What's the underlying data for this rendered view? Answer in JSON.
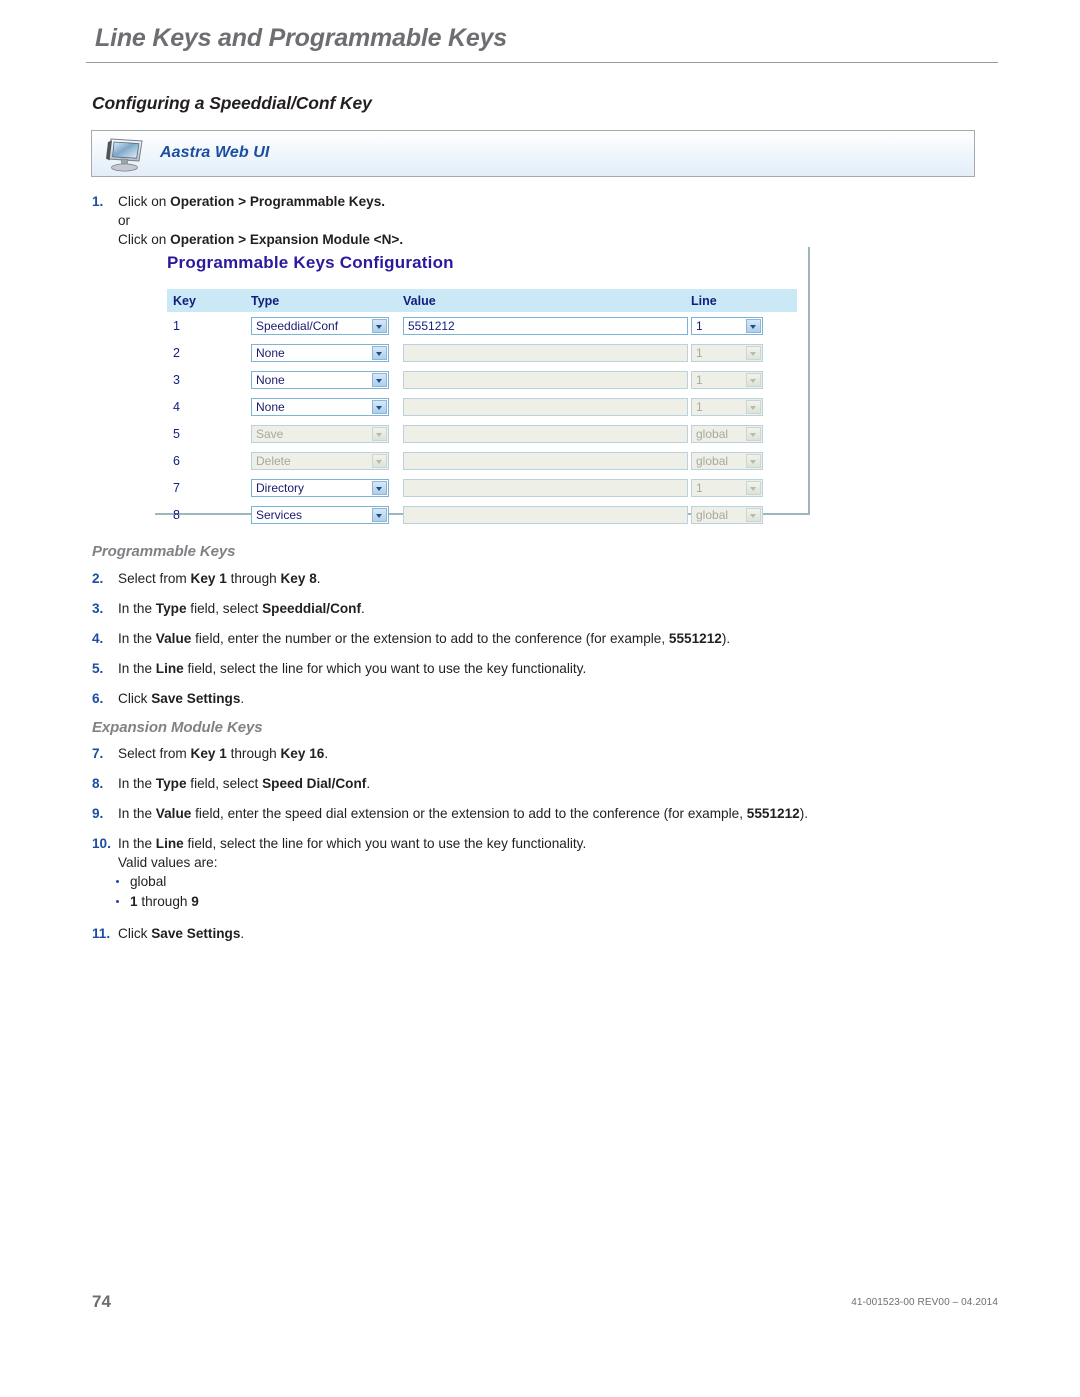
{
  "running_head": "Line Keys and Programmable Keys",
  "section_title": "Configuring a Speeddial/Conf Key",
  "banner": {
    "label": "Aastra Web UI",
    "icon": "monitor-icon",
    "accent_color": "#1b4ea3",
    "background_color": "#e3eef8"
  },
  "steps": {
    "s1": {
      "num": "1.",
      "line1_pre": "Click on ",
      "line1_bold": "Operation > Programmable Keys.",
      "line2": "or",
      "line3_pre": "Click on ",
      "line3_bold": "Operation > Expansion Module <N>."
    },
    "s2": {
      "num": "2.",
      "pre": "Select from ",
      "b1": "Key 1",
      "mid": " through ",
      "b2": "Key 8",
      "post": "."
    },
    "s3": {
      "num": "3.",
      "pre": "In the ",
      "b1": "Type",
      "mid": " field, select ",
      "b2": "Speeddial/Conf",
      "post": "."
    },
    "s4": {
      "num": "4.",
      "pre": "In the ",
      "b1": "Value",
      "mid": " field, enter the number or the extension to add to the conference (for example, ",
      "b2": "5551212",
      "post": ")."
    },
    "s5": {
      "num": "5.",
      "pre": "In the ",
      "b1": "Line",
      "mid": " field, select the line for which you want to use the key functionality.",
      "b2": "",
      "post": ""
    },
    "s6": {
      "num": "6.",
      "pre": "Click ",
      "b1": "Save Settings",
      "mid": "",
      "b2": "",
      "post": "."
    },
    "s7": {
      "num": "7.",
      "pre": "Select from ",
      "b1": "Key 1",
      "mid": " through ",
      "b2": "Key 16",
      "post": "."
    },
    "s8": {
      "num": "8.",
      "pre": "In the ",
      "b1": "Type",
      "mid": " field, select ",
      "b2": "Speed Dial/Conf",
      "post": "."
    },
    "s9": {
      "num": "9.",
      "pre": "In the ",
      "b1": "Value",
      "mid": " field, enter the speed dial extension or the extension to add to the conference (for example, ",
      "b2": "5551212",
      "post": ")."
    },
    "s10": {
      "num": "10.",
      "pre": "In the ",
      "b1": "Line",
      "mid": " field, select the line for which you want to use the key functionality.",
      "valid_label": "Valid values are:",
      "bullets": [
        {
          "pre": "",
          "bold": "",
          "text": "global"
        },
        {
          "pre": "",
          "bold": "1",
          "text": " through ",
          "bold2": "9"
        }
      ]
    },
    "s11": {
      "num": "11.",
      "pre": "Click ",
      "b1": "Save Settings",
      "mid": "",
      "b2": "",
      "post": "."
    }
  },
  "subheads": {
    "programmable_keys": "Programmable Keys",
    "expansion_module_keys": "Expansion Module Keys"
  },
  "screenshot": {
    "title": "Programmable Keys Configuration",
    "columns": [
      "Key",
      "Type",
      "Value",
      "Line"
    ],
    "rows": [
      {
        "key": "1",
        "type": "Speeddial/Conf",
        "type_disabled": false,
        "value": "5551212",
        "value_disabled": false,
        "line": "1",
        "line_disabled": false
      },
      {
        "key": "2",
        "type": "None",
        "type_disabled": false,
        "value": "",
        "value_disabled": true,
        "line": "1",
        "line_disabled": true
      },
      {
        "key": "3",
        "type": "None",
        "type_disabled": false,
        "value": "",
        "value_disabled": true,
        "line": "1",
        "line_disabled": true
      },
      {
        "key": "4",
        "type": "None",
        "type_disabled": false,
        "value": "",
        "value_disabled": true,
        "line": "1",
        "line_disabled": true
      },
      {
        "key": "5",
        "type": "Save",
        "type_disabled": true,
        "value": "",
        "value_disabled": true,
        "line": "global",
        "line_disabled": true
      },
      {
        "key": "6",
        "type": "Delete",
        "type_disabled": true,
        "value": "",
        "value_disabled": true,
        "line": "global",
        "line_disabled": true
      },
      {
        "key": "7",
        "type": "Directory",
        "type_disabled": false,
        "value": "",
        "value_disabled": true,
        "line": "1",
        "line_disabled": true
      },
      {
        "key": "8",
        "type": "Services",
        "type_disabled": false,
        "value": "",
        "value_disabled": true,
        "line": "global",
        "line_disabled": true
      }
    ],
    "header_bg": "#cbe8f7",
    "title_color": "#2b1a9e"
  },
  "footer": {
    "page_number": "74",
    "doc_id": "41-001523-00 REV00 – 04.2014"
  }
}
